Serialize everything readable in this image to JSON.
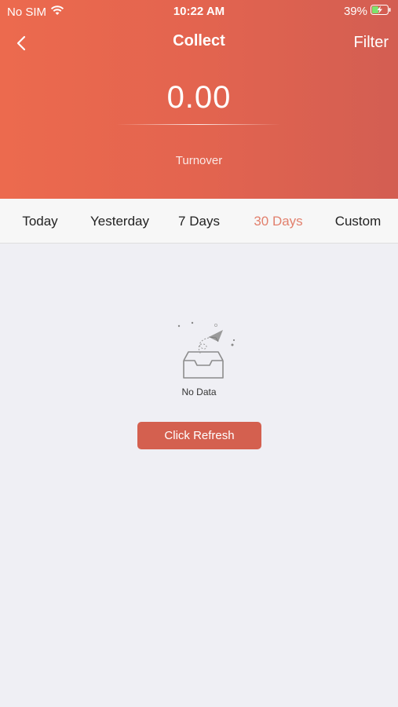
{
  "status_bar": {
    "carrier": "No SIM",
    "time": "10:22 AM",
    "battery_percent": "39%",
    "wifi_icon": "wifi-icon",
    "battery_icon": "battery-charging-icon"
  },
  "nav": {
    "back_icon": "chevron-left-icon",
    "title": "Collect",
    "filter_label": "Filter"
  },
  "summary": {
    "amount": "0.00",
    "label": "Turnover"
  },
  "tabs": [
    {
      "label": "Today",
      "active": false
    },
    {
      "label": "Yesterday",
      "active": false
    },
    {
      "label": "7 Days",
      "active": false
    },
    {
      "label": "30 Days",
      "active": true
    },
    {
      "label": "Custom",
      "active": false
    }
  ],
  "empty_state": {
    "icon": "empty-inbox-paper-plane-icon",
    "text": "No Data",
    "button_label": "Click Refresh"
  },
  "colors": {
    "header_gradient_start": "#ec6a4e",
    "header_gradient_end": "#d35e52",
    "active_tab": "#e2806d",
    "button": "#d4604f",
    "background": "#efeff4"
  }
}
